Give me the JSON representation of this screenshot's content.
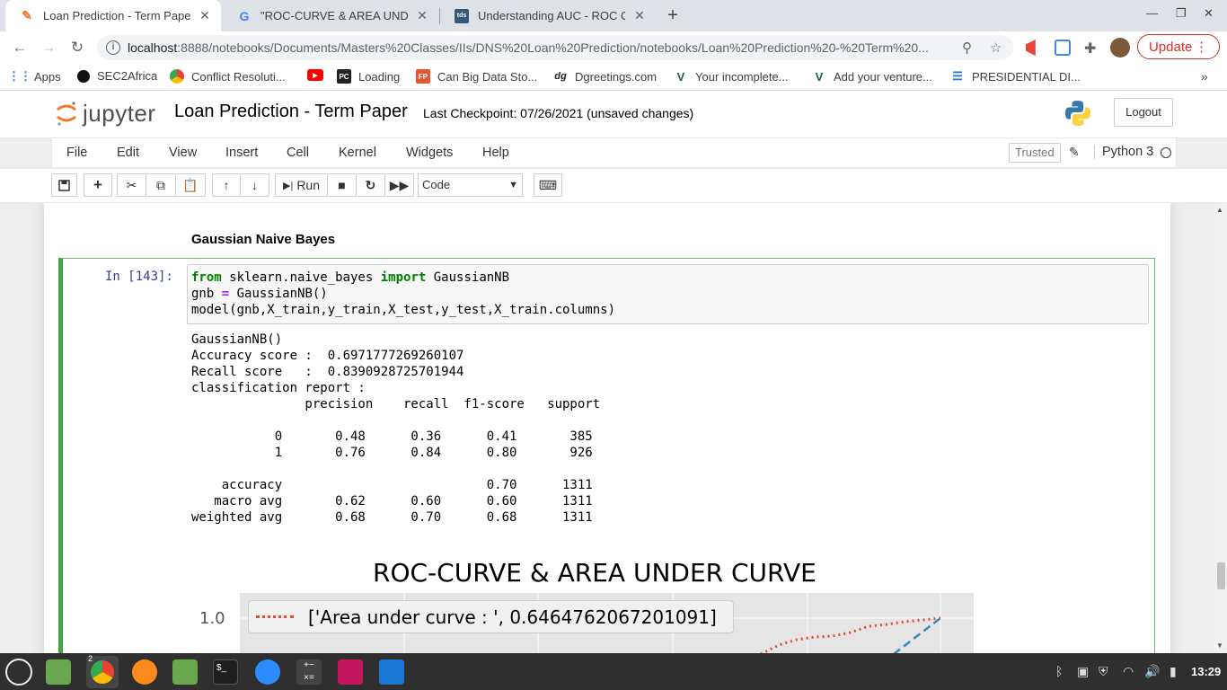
{
  "browser": {
    "tabs": [
      {
        "title": "Loan Prediction - Term Paper",
        "favicon": "jupyter-icon",
        "active": true
      },
      {
        "title": "\"ROC-CURVE & AREA UNDER",
        "favicon": "google-icon",
        "active": false
      },
      {
        "title": "Understanding AUC - ROC Cur",
        "favicon": "tds-icon",
        "active": false
      }
    ],
    "tab3_badge": "tds",
    "url_host": "localhost",
    "url_path": ":8888/notebooks/Documents/Masters%20Classes/IIs/DNS%20Loan%20Prediction/notebooks/Loan%20Prediction%20-%20Term%20...",
    "update_label": "Update",
    "bookmarks": [
      {
        "label": "Apps",
        "icon": "apps-grid-icon"
      },
      {
        "label": "SEC2Africa",
        "icon": "dot-icon"
      },
      {
        "label": "Conflict Resoluti...",
        "icon": "chrome-icon"
      },
      {
        "label": "",
        "icon": "youtube-icon"
      },
      {
        "label": "Loading",
        "icon": "pc-icon"
      },
      {
        "label": "Can Big Data Sto...",
        "icon": "fp-icon"
      },
      {
        "label": "Dgreetings.com",
        "icon": "dg-icon"
      },
      {
        "label": "Your incomplete...",
        "icon": "va-icon"
      },
      {
        "label": "Add your venture...",
        "icon": "va-icon"
      },
      {
        "label": "PRESIDENTIAL DI...",
        "icon": "doc-icon"
      }
    ],
    "bookmark_badges": {
      "pc": "PC",
      "fp": "FP",
      "dg": "dg"
    }
  },
  "jupyter": {
    "logo_text": "jupyter",
    "notebook_title": "Loan Prediction - Term Paper",
    "checkpoint": "Last Checkpoint: 07/26/2021  (unsaved changes)",
    "logout_label": "Logout",
    "menus": [
      "File",
      "Edit",
      "View",
      "Insert",
      "Cell",
      "Kernel",
      "Widgets",
      "Help"
    ],
    "trusted_label": "Trusted",
    "kernel_name": "Python 3",
    "run_label": "Run",
    "cell_type": "Code"
  },
  "notebook": {
    "md_heading": "Gaussian Naive Bayes",
    "prompt": "In [143]:",
    "code": {
      "l1_kw1": "from",
      "l1_mod": " sklearn.naive_bayes ",
      "l1_kw2": "import",
      "l1_name": " GaussianNB",
      "l2_a": "gnb ",
      "l2_op": "=",
      "l2_b": " GaussianNB()",
      "l3": "model(gnb,X_train,y_train,X_test,y_test,X_train.columns)"
    },
    "output_text": "GaussianNB()\nAccuracy score :  0.6971777269260107\nRecall score   :  0.8390928725701944\nclassification report :\n               precision    recall  f1-score   support\n\n           0       0.48      0.36      0.41       385\n           1       0.76      0.84      0.80       926\n\n    accuracy                           0.70      1311\n   macro avg       0.62      0.60      0.60      1311\nweighted avg       0.68      0.70      0.68      1311",
    "plot_title": "ROC-CURVE & AREA UNDER CURVE",
    "ytick_top": "1.0",
    "legend_label": "['Area under curve : ', 0.6464762067201091]"
  },
  "taskbar": {
    "clock": "13:29",
    "chrome_badge": "2"
  },
  "colors": {
    "jupyter_orange": "#f37726",
    "cell_green": "#42a545",
    "roc_red": "#e24a33",
    "diag_blue": "#348abd",
    "update_red": "#d93025"
  }
}
